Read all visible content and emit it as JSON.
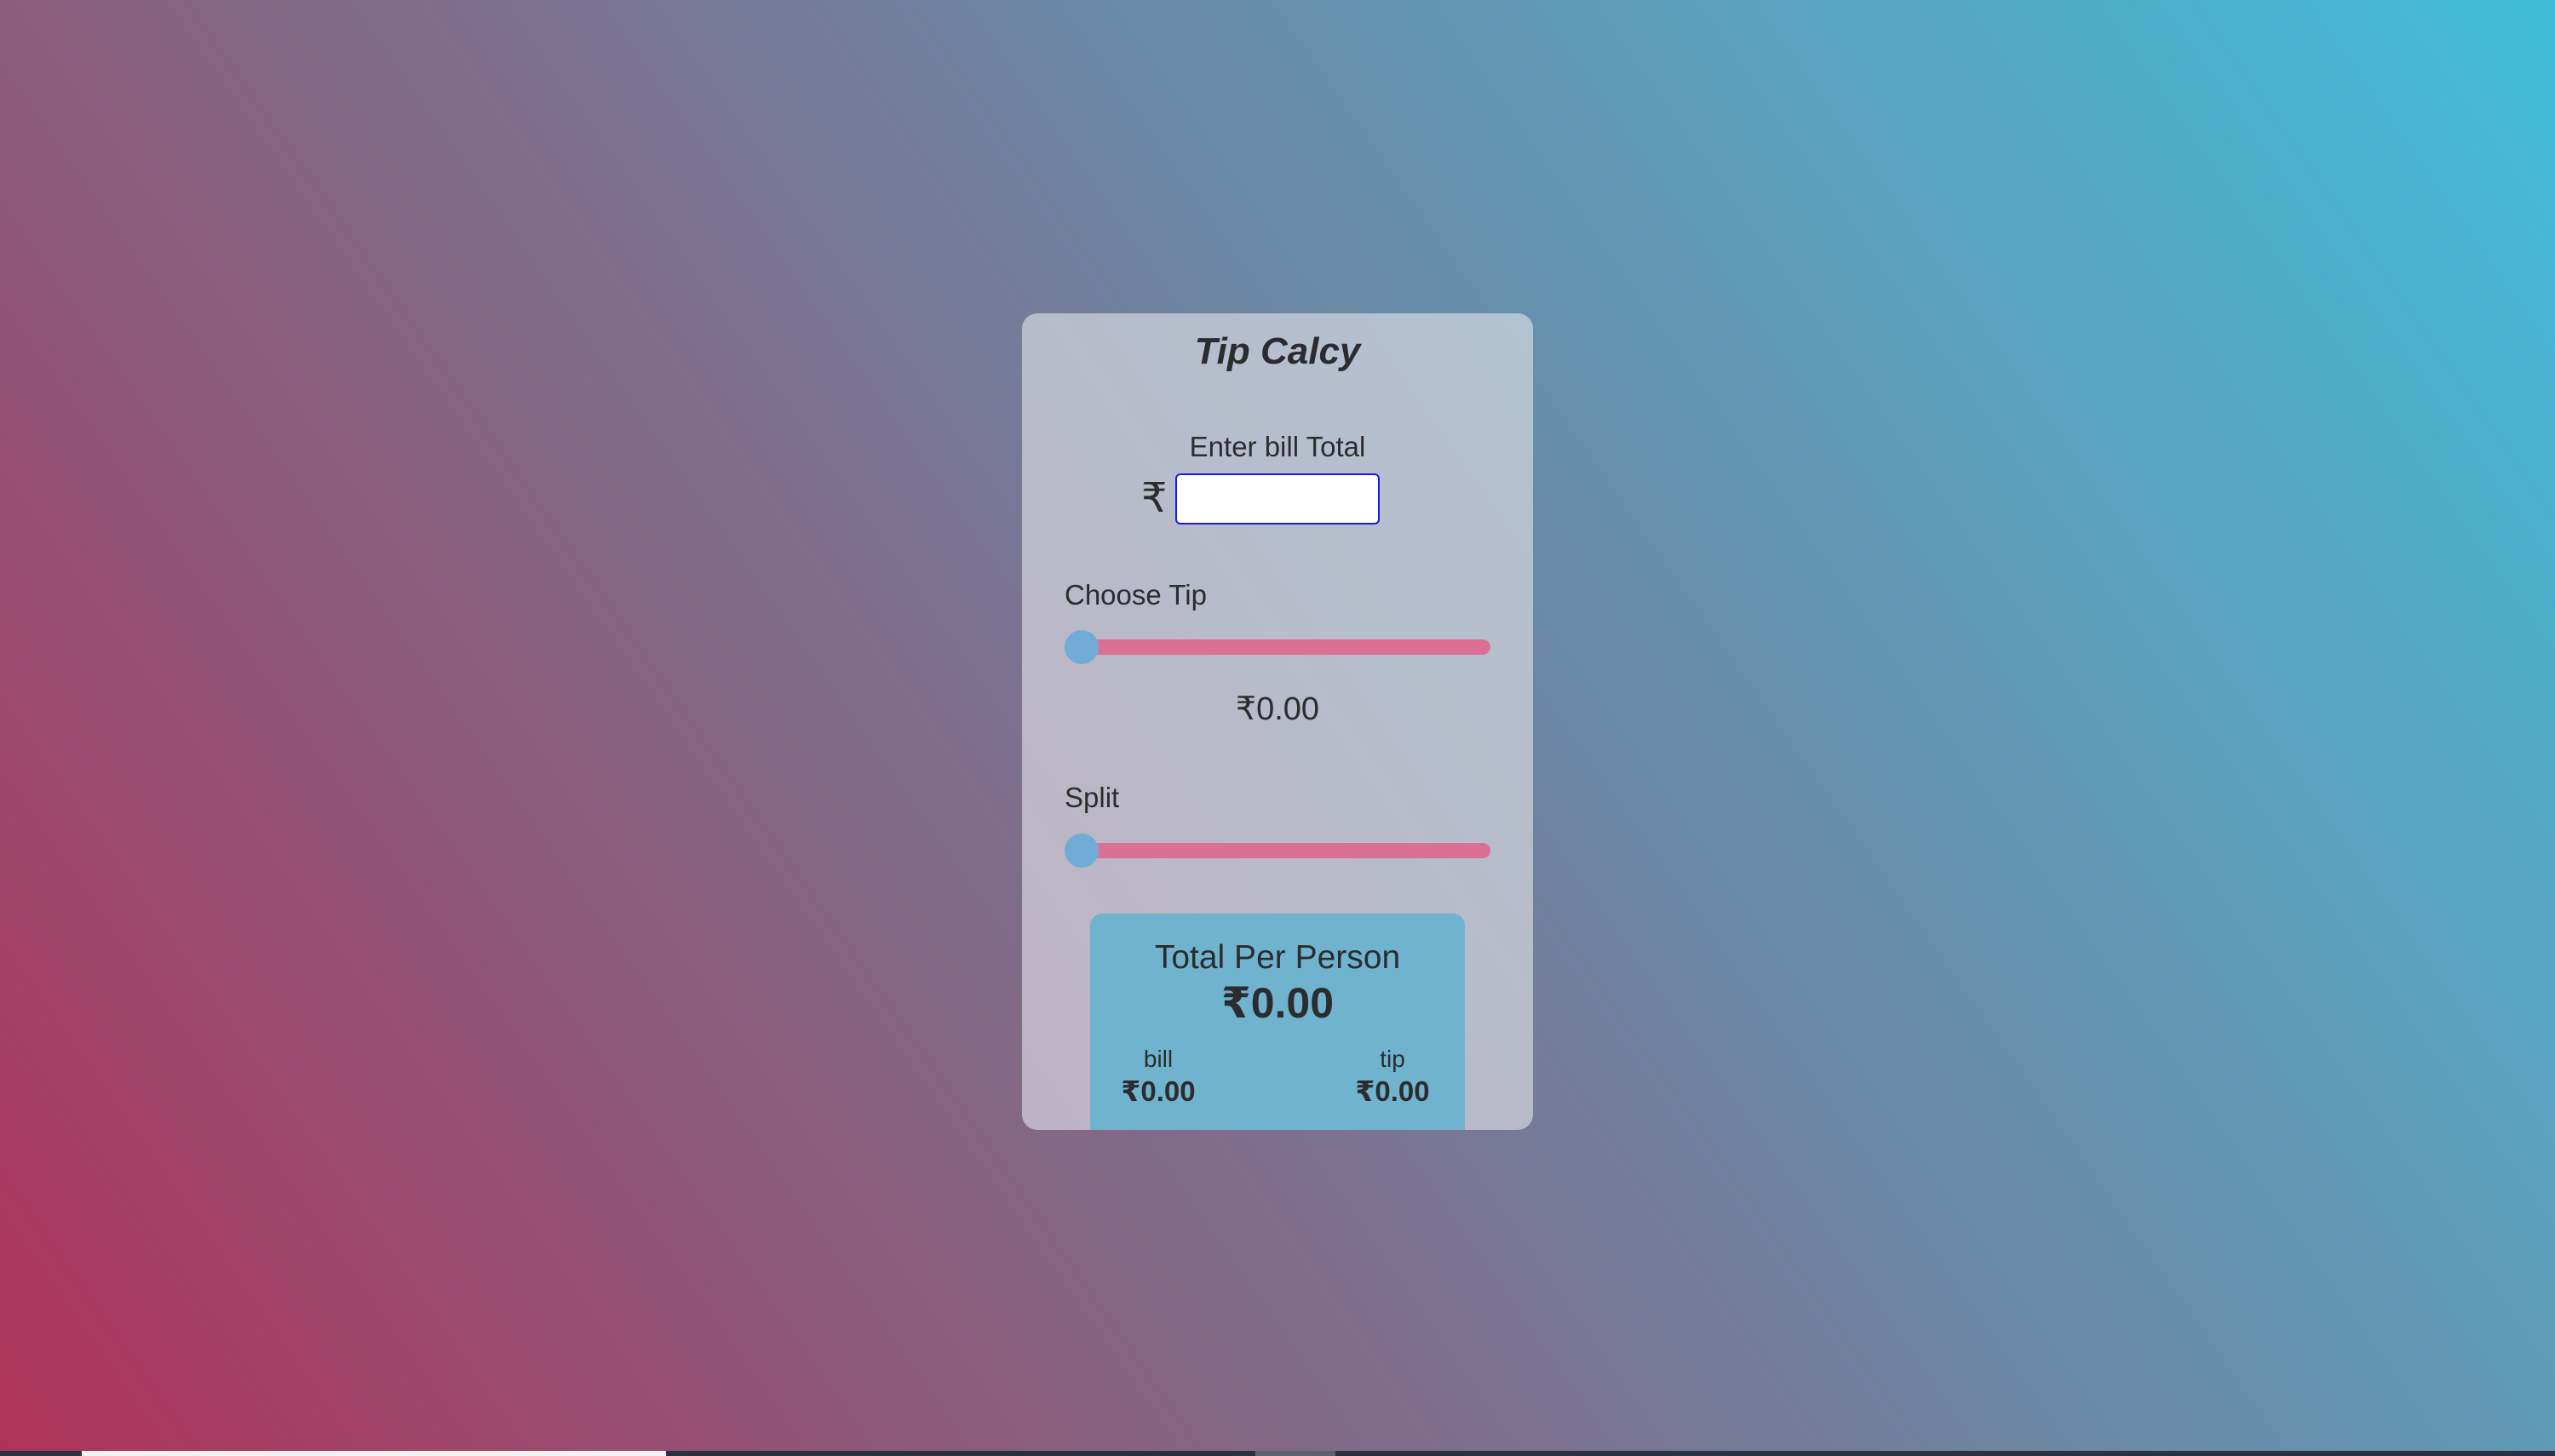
{
  "app": {
    "title": "Tip Calcy"
  },
  "bill": {
    "label": "Enter bill Total",
    "currency_symbol": "₹",
    "value": "",
    "placeholder": ""
  },
  "tip": {
    "label": "Choose Tip",
    "slider_value_fraction": 0,
    "amount": "₹0.00"
  },
  "split": {
    "label": "Split",
    "slider_value_fraction": 0
  },
  "result": {
    "title": "Total Per Person",
    "total": "₹0.00",
    "bill_label": "bill",
    "bill_value": "₹0.00",
    "tip_label": "tip",
    "tip_value": "₹0.00"
  },
  "colors": {
    "slider_track": "#dc7094",
    "slider_thumb": "#71acd6",
    "result_box": "#70b3cf",
    "input_border": "#1a1ae6"
  }
}
